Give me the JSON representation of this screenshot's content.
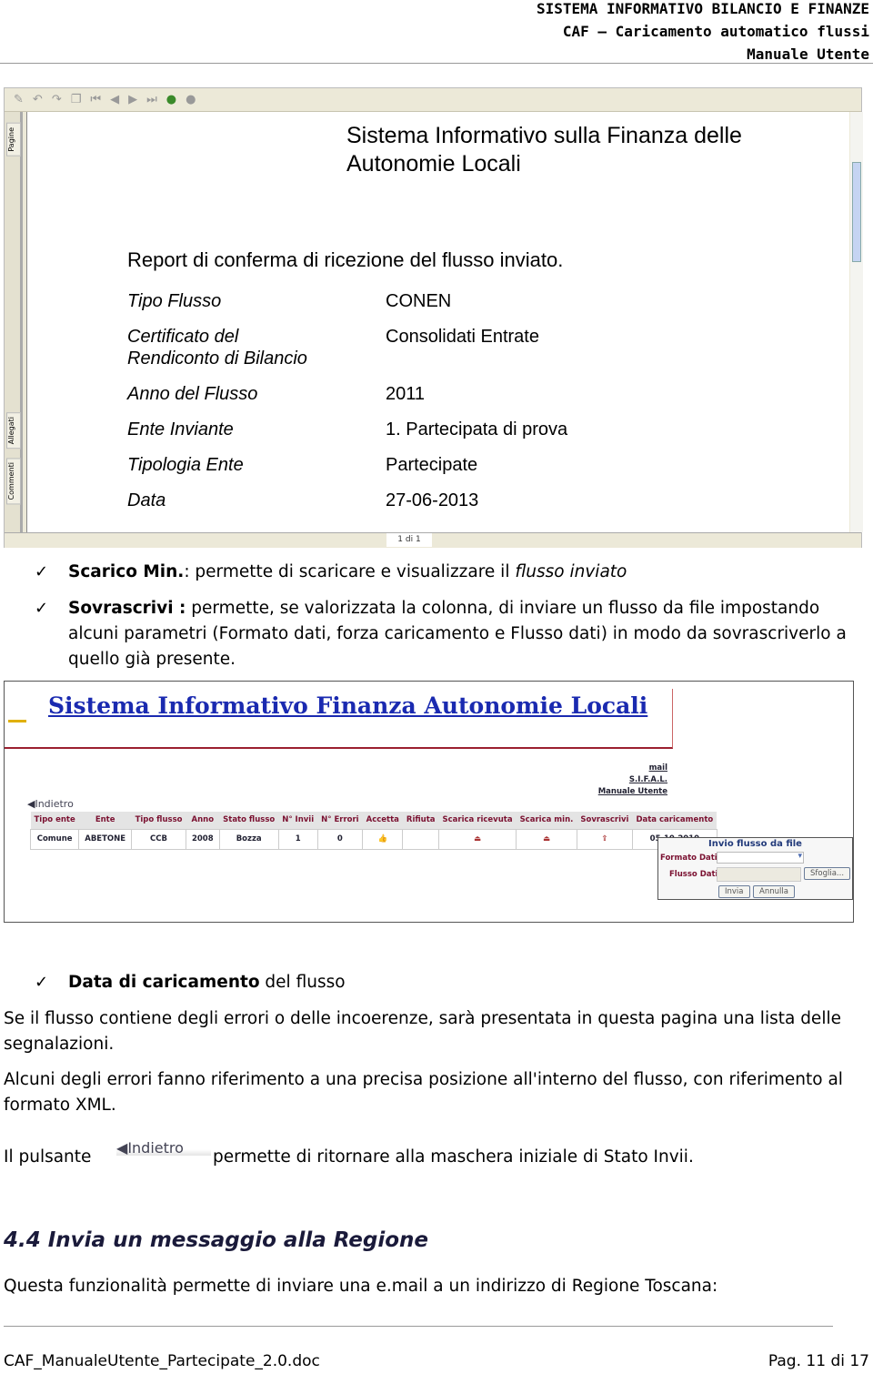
{
  "header": {
    "line1": "SISTEMA INFORMATIVO BILANCIO E FINANZE",
    "line2": "CAF – Caricamento automatico flussi",
    "line3": "Manuale Utente"
  },
  "viewer": {
    "side_tabs": [
      "Pagine",
      "Allegati",
      "Commenti"
    ],
    "page_indicator": "1 di 1",
    "report": {
      "title_line1": "Sistema Informativo sulla Finanza delle",
      "title_line2": "Autonomie Locali",
      "subtitle": "Report di conferma di ricezione del flusso inviato.",
      "rows": [
        {
          "label": "Tipo Flusso",
          "value": "CONEN"
        },
        {
          "label1": "Certificato del",
          "label2": "Rendiconto di Bilancio",
          "value": "Consolidati Entrate"
        },
        {
          "label": "Anno del Flusso",
          "value": "2011"
        },
        {
          "label": "Ente Inviante",
          "value": "1. Partecipata di prova"
        },
        {
          "label": "Tipologia Ente",
          "value": "Partecipate"
        },
        {
          "label": "Data",
          "value": "27-06-2013"
        }
      ]
    }
  },
  "bullets": [
    {
      "bold": "Scarico Min.",
      "text": ": permette di scaricare e visualizzare il ",
      "italic": "flusso inviato"
    },
    {
      "bold": "Sovrascrivi :",
      "text": " permette, se valorizzata la colonna, di inviare un flusso da file impostando alcuni parametri (Formato dati, forza caricamento e Flusso dati) in modo da sovrascriverlo a quello già presente."
    },
    {
      "bold": "Data di caricamento",
      "text": " del flusso"
    }
  ],
  "app": {
    "title": "Sistema Informativo Finanza Autonomie Locali",
    "links": [
      "mail",
      "S.I.F.A.L.",
      "Manuale Utente"
    ],
    "back": "Indietro",
    "columns": [
      "Tipo ente",
      "Ente",
      "Tipo flusso",
      "Anno",
      "Stato flusso",
      "N° Invii",
      "N° Errori",
      "Accetta",
      "Rifiuta",
      "Scarica ricevuta",
      "Scarica min.",
      "Sovrascrivi",
      "Data caricamento"
    ],
    "row": [
      "Comune",
      "ABETONE",
      "CCB",
      "2008",
      "Bozza",
      "1",
      "0",
      "",
      "",
      "",
      "",
      "",
      "05-10-2010"
    ],
    "invio": {
      "title": "Invio flusso da file",
      "formato_label": "Formato Dati",
      "flusso_label": "Flusso Dati",
      "browse": "Sfoglia...",
      "send": "Invia",
      "cancel": "Annulla"
    }
  },
  "paragraphs": {
    "p1": "Se il flusso contiene degli errori o delle incoerenze, sarà presentata in questa pagina una lista delle segnalazioni.",
    "p2": "Alcuni degli errori fanno riferimento a una precisa posizione all'interno del flusso, con riferimento al formato XML.",
    "p3a": "Il pulsante",
    "p3_button": "Indietro",
    "p3b": "permette di ritornare alla maschera iniziale di Stato Invii.",
    "section": "4.4  Invia un messaggio alla Regione",
    "p4": "Questa funzionalità permette di inviare una e.mail a un indirizzo di Regione Toscana:"
  },
  "footer": {
    "file": "CAF_ManualeUtente_Partecipate_2.0.doc",
    "page": "Pag. 11 di 17"
  }
}
